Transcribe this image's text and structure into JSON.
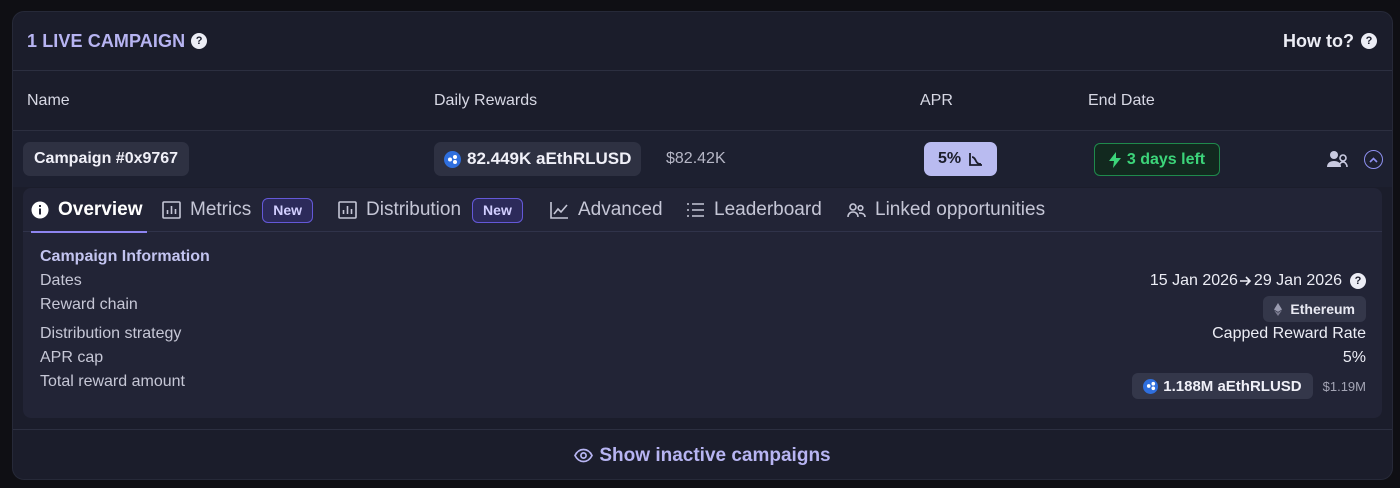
{
  "header": {
    "title": "1 LIVE CAMPAIGN",
    "howto_label": "How to?"
  },
  "columns": {
    "name": "Name",
    "daily_rewards": "Daily Rewards",
    "apr": "APR",
    "end_date": "End Date"
  },
  "campaign": {
    "name": "Campaign #0x9767",
    "daily_reward_amount": "82.449K aEthRLUSD",
    "daily_reward_usd": "$82.42K",
    "apr": "5%",
    "end": "3 days left"
  },
  "tabs": [
    {
      "label": "Overview",
      "icon": "info-icon"
    },
    {
      "label": "Metrics",
      "icon": "bar-chart-icon",
      "badge": "New"
    },
    {
      "label": "Distribution",
      "icon": "bar-chart-icon",
      "badge": "New"
    },
    {
      "label": "Advanced",
      "icon": "line-chart-icon"
    },
    {
      "label": "Leaderboard",
      "icon": "list-icon"
    },
    {
      "label": "Linked opportunities",
      "icon": "users-icon"
    }
  ],
  "info": {
    "title": "Campaign Information",
    "rows": [
      {
        "label": "Dates",
        "start": "15 Jan 2026",
        "end": "29 Jan 2026"
      },
      {
        "label": "Reward chain",
        "value": "Ethereum"
      },
      {
        "label": "Distribution strategy",
        "value": "Capped Reward Rate"
      },
      {
        "label": "APR cap",
        "value": "5%"
      },
      {
        "label": "Total reward amount",
        "value": "1.188M aEthRLUSD",
        "usd": "$1.19M"
      }
    ]
  },
  "footer": {
    "label": "Show inactive campaigns"
  },
  "colors": {
    "accent": "#b7b4f2",
    "green": "#3cd57a",
    "token_blue": "#2f6fde"
  }
}
